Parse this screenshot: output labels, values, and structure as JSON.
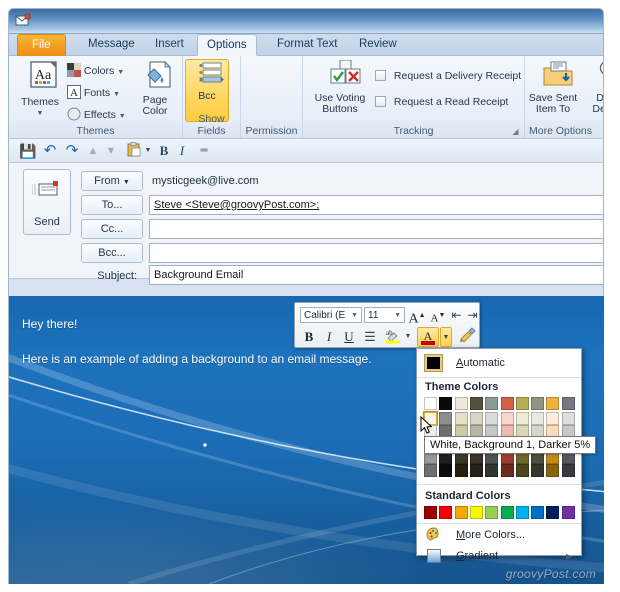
{
  "window": {
    "app_icon": "new-email-message-icon"
  },
  "ribbon": {
    "tabs": [
      {
        "label": "File",
        "active": false
      },
      {
        "label": "Message",
        "active": false
      },
      {
        "label": "Insert",
        "active": false
      },
      {
        "label": "Options",
        "active": true
      },
      {
        "label": "Format Text",
        "active": false
      },
      {
        "label": "Review",
        "active": false
      }
    ],
    "groups": [
      {
        "label": "Themes"
      },
      {
        "label": "Show Fields"
      },
      {
        "label": "Permission"
      },
      {
        "label": "Tracking"
      },
      {
        "label": "More Options"
      }
    ],
    "themes": {
      "themes_button": "Themes",
      "colors": "Colors",
      "fonts": "Fonts",
      "effects": "Effects",
      "page_color_line1": "Page",
      "page_color_line2": "Color"
    },
    "show_fields": {
      "bcc": "Bcc"
    },
    "tracking": {
      "voting_line1": "Use Voting",
      "voting_line2": "Buttons",
      "delivery_receipt": "Request a Delivery Receipt",
      "read_receipt": "Request a Read Receipt"
    },
    "more_options": {
      "save_sent_line1": "Save Sent",
      "save_sent_line2": "Item To",
      "delay_line1": "Dela",
      "delay_line2": "Delive"
    }
  },
  "qat": {
    "items": [
      {
        "name": "save-icon",
        "glyph": "▣"
      },
      {
        "name": "undo-icon",
        "glyph": "↶"
      },
      {
        "name": "redo-icon",
        "glyph": "↷"
      },
      {
        "name": "previous-item-icon",
        "glyph": "▲"
      },
      {
        "name": "next-item-icon",
        "glyph": "▼"
      },
      {
        "name": "paste-icon",
        "glyph": "▤"
      },
      {
        "name": "bold-icon",
        "glyph": "B"
      },
      {
        "name": "italic-icon",
        "glyph": "I"
      },
      {
        "name": "customize-qat-icon",
        "glyph": "☰"
      }
    ]
  },
  "compose": {
    "send_button": "Send",
    "from_button": "From",
    "from_value": "mysticgeek@live.com",
    "to_button": "To...",
    "to_value": "Steve  <Steve@groovyPost.com>;",
    "cc_button": "Cc...",
    "cc_value": "",
    "bcc_button": "Bcc...",
    "bcc_value": "",
    "subject_label": "Subject:",
    "subject_value": "Background Email",
    "body_lines": [
      "Hey there!",
      "Here is an example of adding a background to an email message."
    ]
  },
  "mini_toolbar": {
    "font_name": "Calibri (E",
    "font_size": "11",
    "grow_font": "A",
    "shrink_font": "A",
    "decrease_indent": "≡",
    "increase_indent": "≡",
    "bold": "B",
    "italic": "I",
    "underline": "U",
    "align": "≡",
    "highlight": "ab",
    "font_color": "A",
    "format_painter": "✒"
  },
  "color_menu": {
    "automatic": "Automatic",
    "theme_colors_header": "Theme Colors",
    "standard_colors_header": "Standard Colors",
    "more_colors": "More Colors...",
    "gradient": "Gradient",
    "tooltip": "White, Background 1, Darker 5%",
    "theme_rows": [
      [
        "#ffffff",
        "#000000",
        "#eeece1",
        "#1f497d",
        "#4f81bd",
        "#c0504d",
        "#9bbb59",
        "#8064a2",
        "#4bacc6",
        "#f79646"
      ],
      [
        "#f2f2f2",
        "#7f7f7f",
        "#ddd9c3",
        "#c6d9f0",
        "#dbe5f1",
        "#f2dcdb",
        "#ebf1dd",
        "#e5e0ec",
        "#dbeef3",
        "#fdeada"
      ],
      [
        "#d8d8d8",
        "#595959",
        "#c4bd97",
        "#8db3e2",
        "#b8cce4",
        "#e5b9b7",
        "#d7e3bc",
        "#ccc1d9",
        "#b7dde8",
        "#fbd5b5"
      ],
      [
        "#bfbfbf",
        "#3f3f3f",
        "#938953",
        "#548dd4",
        "#95b3d7",
        "#d99694",
        "#c3d69b",
        "#b2a2c7",
        "#92cddc",
        "#fac08f"
      ],
      [
        "#a5a5a5",
        "#262626",
        "#494429",
        "#17365d",
        "#366092",
        "#953734",
        "#76923c",
        "#5f497a",
        "#31859b",
        "#e36c09"
      ],
      [
        "#7f7f7f",
        "#0c0c0c",
        "#1d1b10",
        "#0f243e",
        "#244061",
        "#632423",
        "#4f6128",
        "#3f3151",
        "#205867",
        "#974806"
      ]
    ],
    "theme_rows_rendered": [
      [
        "#fdfdfa",
        "#0a0a0a",
        "#eceadb",
        "#56503f",
        "#8a9a96",
        "#d75f4a",
        "#b6ae52",
        "#8f9683",
        "#eeb13a",
        "#7c7480"
      ],
      [
        "#f6f5ef",
        "#8d8d8d",
        "#e3e0c8",
        "#d8d5c8",
        "#d9dedd",
        "#f7d5cd",
        "#eeecd5",
        "#e9e9e4",
        "#fdeedc",
        "#dedede"
      ],
      [
        "#ededed",
        "#6e6e6e",
        "#cfcaa4",
        "#bab4a4",
        "#c2c9c6",
        "#efb9ad",
        "#dcd8b2",
        "#d6d6ce",
        "#fbdcb6",
        "#c8c8c8"
      ],
      [
        "#c8c8c8",
        "#4a4a4a",
        "#a49a72",
        "#938b78",
        "#9aa49f",
        "#dd9a8b",
        "#c4be8b",
        "#b9b9ae",
        "#f5c78c",
        "#a8a8a8"
      ],
      [
        "#9b9b9b",
        "#202020",
        "#3c3823",
        "#3a352a",
        "#4d5651",
        "#9c3f31",
        "#6f6a2c",
        "#4c4f3e",
        "#c48a1c",
        "#5a5460"
      ],
      [
        "#6e6e6e",
        "#0c0c0c",
        "#24210f",
        "#26221a",
        "#303733",
        "#6c2b21",
        "#4b471c",
        "#34382b",
        "#8a620f",
        "#3c3842"
      ]
    ],
    "standard_colors": [
      "#9c0000",
      "#f60000",
      "#f6a800",
      "#f7f700",
      "#93d050",
      "#00b050",
      "#00b0f0",
      "#0070c0",
      "#002060",
      "#7030a0"
    ]
  },
  "watermark": "groovyPost.com"
}
